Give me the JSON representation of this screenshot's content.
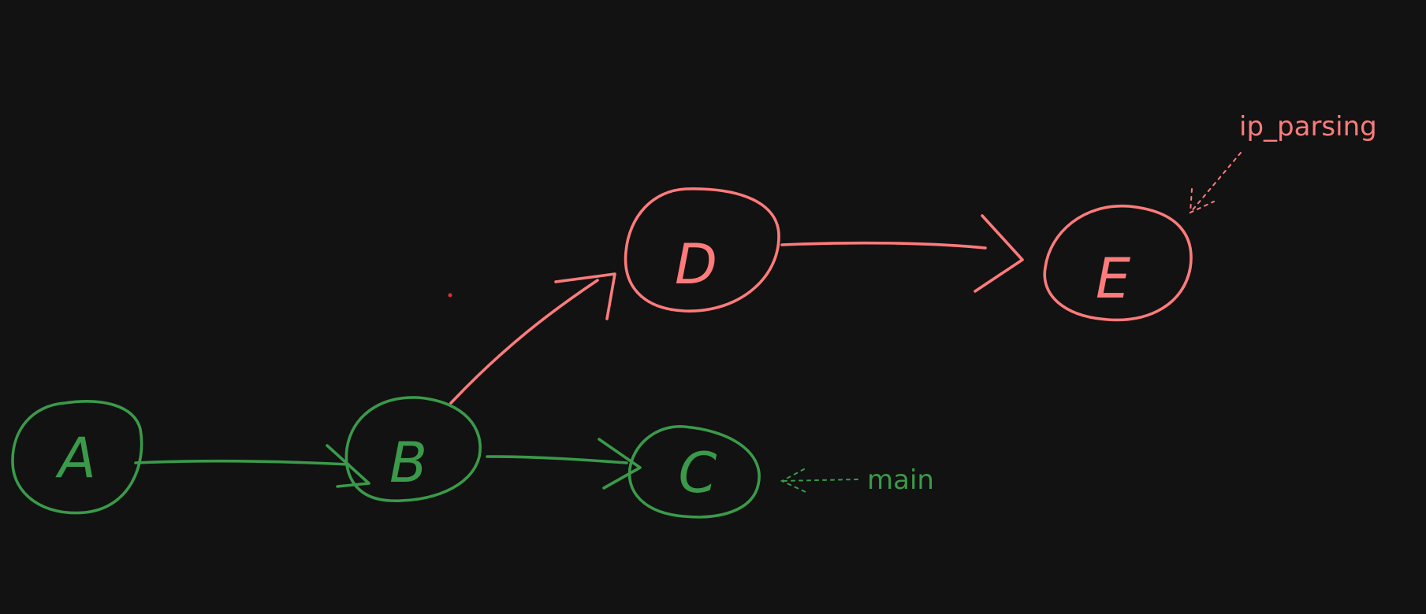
{
  "colors": {
    "background": "#121212",
    "main": "#3a9a4a",
    "ip_parsing": "#ff7b7b"
  },
  "nodes": [
    {
      "id": "A",
      "label": "A",
      "branch": "main"
    },
    {
      "id": "B",
      "label": "B",
      "branch": "main"
    },
    {
      "id": "C",
      "label": "C",
      "branch": "main"
    },
    {
      "id": "D",
      "label": "D",
      "branch": "ip_parsing"
    },
    {
      "id": "E",
      "label": "E",
      "branch": "ip_parsing"
    }
  ],
  "edges": [
    {
      "from": "A",
      "to": "B",
      "branch": "main"
    },
    {
      "from": "B",
      "to": "C",
      "branch": "main"
    },
    {
      "from": "B",
      "to": "D",
      "branch": "ip_parsing"
    },
    {
      "from": "D",
      "to": "E",
      "branch": "ip_parsing"
    }
  ],
  "branch_labels": {
    "main": "main",
    "ip_parsing": "ip_parsing"
  }
}
